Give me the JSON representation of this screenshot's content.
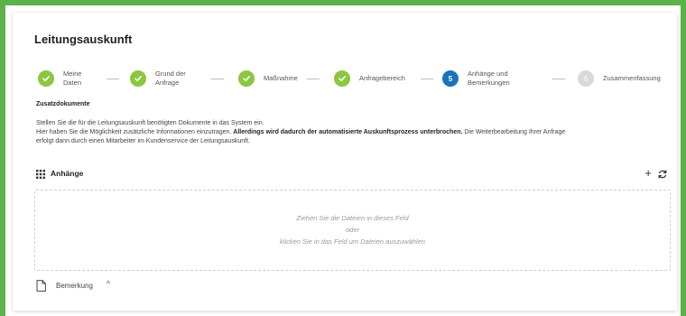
{
  "page": {
    "title": "Leitungsauskunft"
  },
  "stepper": {
    "steps": [
      {
        "state": "done",
        "number": "",
        "label_line1": "Meine",
        "label_line2": "Daten"
      },
      {
        "state": "done",
        "number": "",
        "label_line1": "Grund der",
        "label_line2": "Anfrage"
      },
      {
        "state": "done",
        "number": "",
        "label_line1": "Maßnahme",
        "label_line2": ""
      },
      {
        "state": "done",
        "number": "",
        "label_line1": "Anfragebereich",
        "label_line2": ""
      },
      {
        "state": "active",
        "number": "5",
        "label_line1": "Anhänge und",
        "label_line2": "Bemerkungen"
      },
      {
        "state": "todo",
        "number": "6",
        "label_line1": "Zusammenfassung",
        "label_line2": ""
      }
    ]
  },
  "section": {
    "heading": "Zusatzdokumente",
    "line1": "Stellen Sie die für die Leitungsauskunft benötigten Dokumente in das System ein.",
    "line2_start": "Hier haben Sie die Möglichkeit zusätzliche Informationen einzutragen. ",
    "line2_bold": "Allerdings wird dadurch der automatisierte Auskunftsprozess unterbrochen.",
    "line2_end": " Die Weiterbearbeitung Ihrer Anfrage",
    "line3": "erfolgt dann durch einen Mitarbeiter im Kundenservice der Leitungsauskunft."
  },
  "attachments": {
    "title": "Anhänge",
    "add_icon": "plus-icon",
    "refresh_icon": "refresh-icon",
    "dropzone_line1": "Ziehen Sie die Dateien in dieses Feld",
    "dropzone_line2": "oder",
    "dropzone_line3": "klicken Sie in das Feld um Dateien auszuwählen"
  },
  "remark": {
    "label": "Bemerkung",
    "icon": "document-icon",
    "toggle_icon": "chevron-up-icon"
  },
  "colors": {
    "frame": "#5bb14a",
    "done": "#8dc63f",
    "active": "#1a73b8",
    "todo": "#d9d9d9"
  }
}
